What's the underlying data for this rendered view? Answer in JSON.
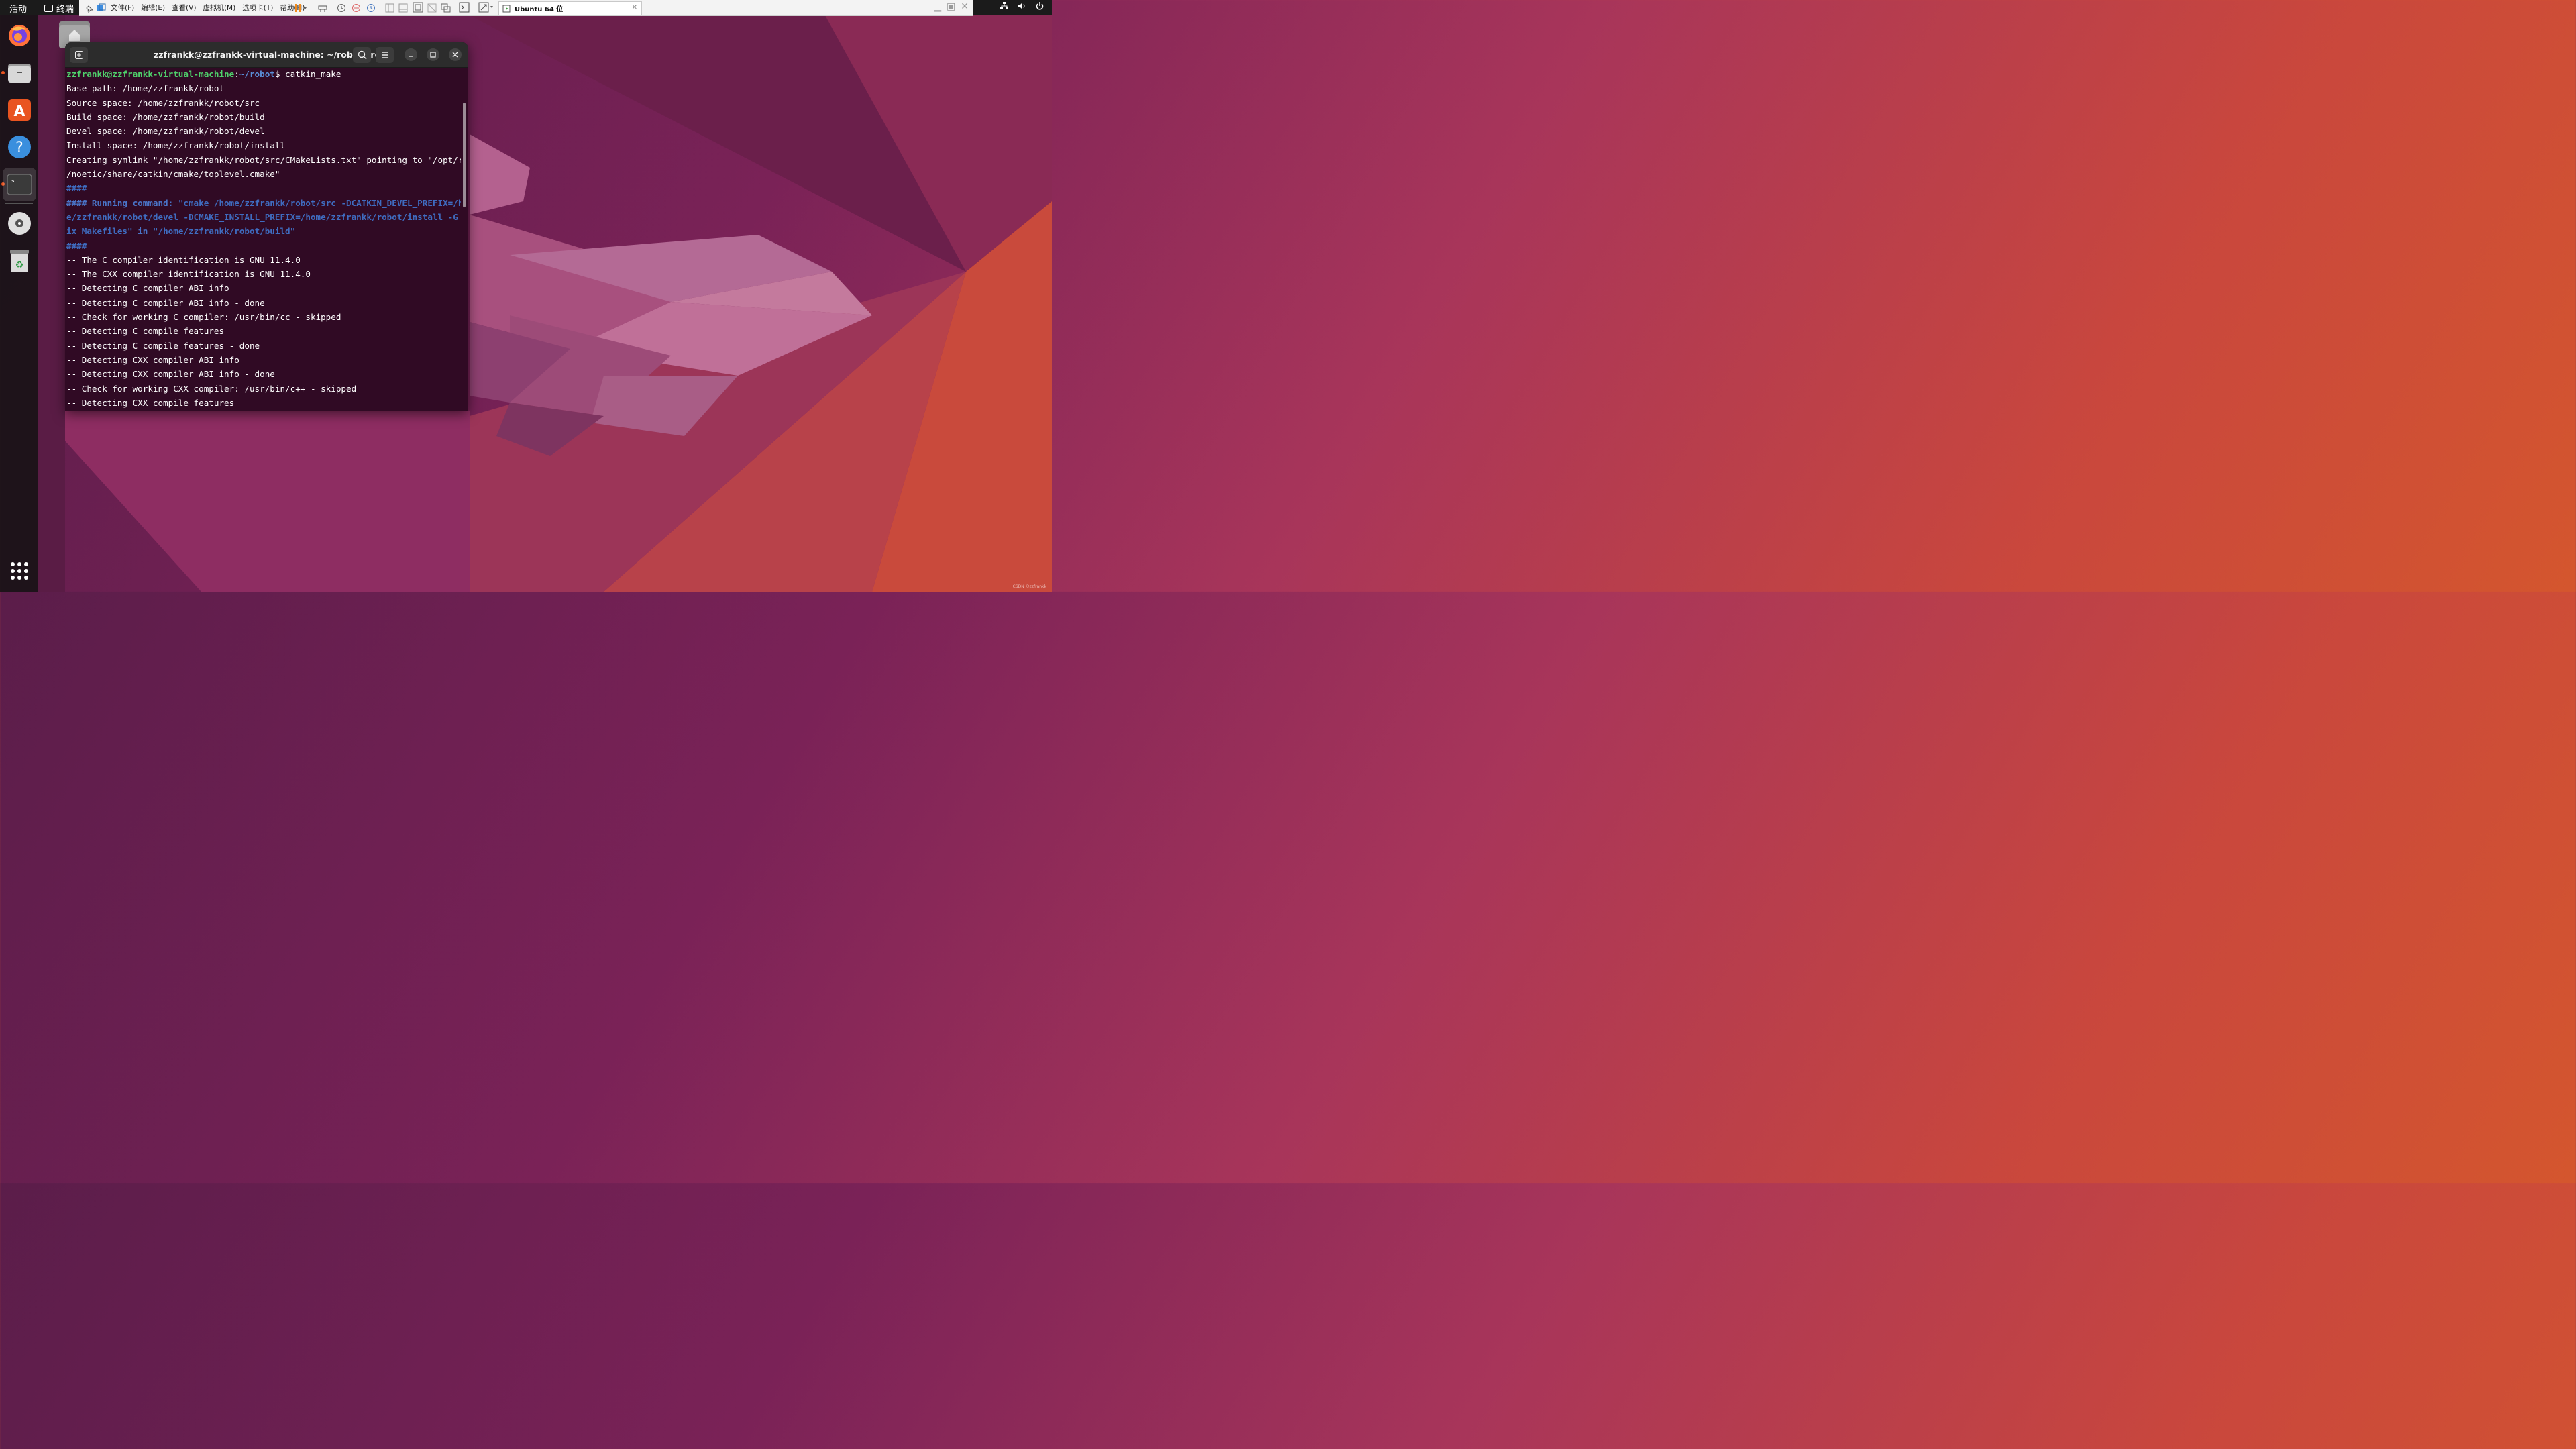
{
  "topbar": {
    "activities": "活动",
    "app_name": "终端"
  },
  "vm": {
    "menu": [
      "文件(F)",
      "编辑(E)",
      "查看(V)",
      "虚拟机(M)",
      "选项卡(T)",
      "帮助(H)"
    ],
    "tab_label": "Ubuntu 64 位",
    "tab_close": "✕"
  },
  "dock": {
    "items": [
      "firefox-icon",
      "files-icon",
      "app-center-icon",
      "help-icon",
      "terminal-icon",
      "dvd-icon",
      "trash-icon"
    ]
  },
  "terminal": {
    "title": "zzfrankk@zzfrankk-virtual-machine: ~/robot/src",
    "prompt_user": "zzfrankk@zzfrankk-virtual-machine",
    "prompt_sep": ":",
    "prompt_path": "~/robot",
    "prompt_cmd": "$ catkin_make",
    "lines": [
      "Base path: /home/zzfrankk/robot",
      "Source space: /home/zzfrankk/robot/src",
      "Build space: /home/zzfrankk/robot/build",
      "Devel space: /home/zzfrankk/robot/devel",
      "Install space: /home/zzfrankk/robot/install",
      "Creating symlink \"/home/zzfrankk/robot/src/CMakeLists.txt\" pointing to \"/opt/ros",
      "/noetic/share/catkin/cmake/toplevel.cmake\""
    ],
    "hash1": "####",
    "running_prefix": "#### Running command: ",
    "running_cmd1": "\"cmake /home/zzfrankk/robot/src -DCATKIN_DEVEL_PREFIX=/hom",
    "running_cmd2": "e/zzfrankk/robot/devel -DCMAKE_INSTALL_PREFIX=/home/zzfrankk/robot/install -G Un",
    "running_cmd3a": "ix Makefiles\"",
    "running_in": " in ",
    "running_cmd3b": "\"/home/zzfrankk/robot/build\"",
    "hash2": "####",
    "cmake_lines": [
      "-- The C compiler identification is GNU 11.4.0",
      "-- The CXX compiler identification is GNU 11.4.0",
      "-- Detecting C compiler ABI info",
      "-- Detecting C compiler ABI info - done",
      "-- Check for working C compiler: /usr/bin/cc - skipped",
      "-- Detecting C compile features",
      "-- Detecting C compile features - done",
      "-- Detecting CXX compiler ABI info",
      "-- Detecting CXX compiler ABI info - done",
      "-- Check for working CXX compiler: /usr/bin/c++ - skipped",
      "-- Detecting CXX compile features"
    ]
  },
  "watermark": "CSDN @zzfrankk",
  "colors": {
    "terminal_bg": "#300a24",
    "prompt_green": "#4fd16b",
    "prompt_blue": "#5a8fd8",
    "ubuntu_orange": "#e95420"
  }
}
